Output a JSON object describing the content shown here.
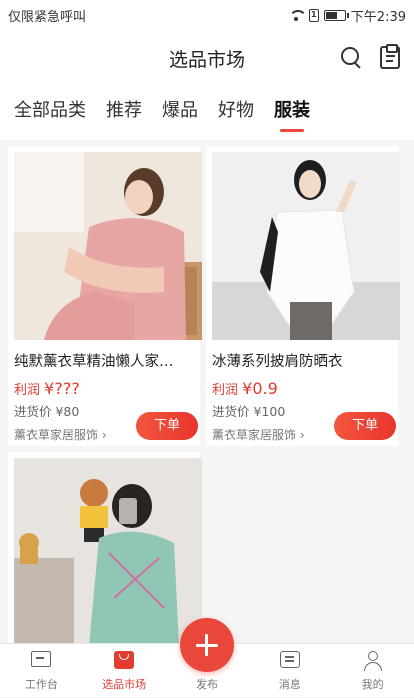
{
  "status_bar": {
    "carrier": "仅限紧急呼叫",
    "time": "下午2:39",
    "sim_badge": "1"
  },
  "header": {
    "title": "选品市场"
  },
  "tabs": [
    {
      "label": "全部品类",
      "active": false
    },
    {
      "label": "推荐",
      "active": false
    },
    {
      "label": "爆品",
      "active": false
    },
    {
      "label": "好物",
      "active": false
    },
    {
      "label": "服装",
      "active": true
    }
  ],
  "products": [
    {
      "name": "纯默薰衣草精油懒人家…",
      "profit_label": "利润",
      "profit_value": "¥???",
      "cost": "进货价 ¥80",
      "shop": "薰衣草家居服饰 ›",
      "button": "下单"
    },
    {
      "name": "冰薄系列披肩防晒衣",
      "profit_label": "利润",
      "profit_value": "¥0.9",
      "cost": "进货价 ¥100",
      "shop": "薰衣草家居服饰 ›",
      "button": "下单"
    },
    {
      "name": "",
      "profit_label": "",
      "profit_value": "",
      "cost": "",
      "shop": "",
      "button": ""
    }
  ],
  "tabbar": [
    {
      "label": "工作台",
      "icon": "desk-icon",
      "active": false
    },
    {
      "label": "选品市场",
      "icon": "market-icon",
      "active": true
    },
    {
      "label": "发布",
      "icon": "plus-icon",
      "active": false
    },
    {
      "label": "消息",
      "icon": "message-icon",
      "active": false
    },
    {
      "label": "我的",
      "icon": "profile-icon",
      "active": false
    }
  ],
  "colors": {
    "accent": "#e94a3b",
    "profit": "#e03a2f"
  }
}
